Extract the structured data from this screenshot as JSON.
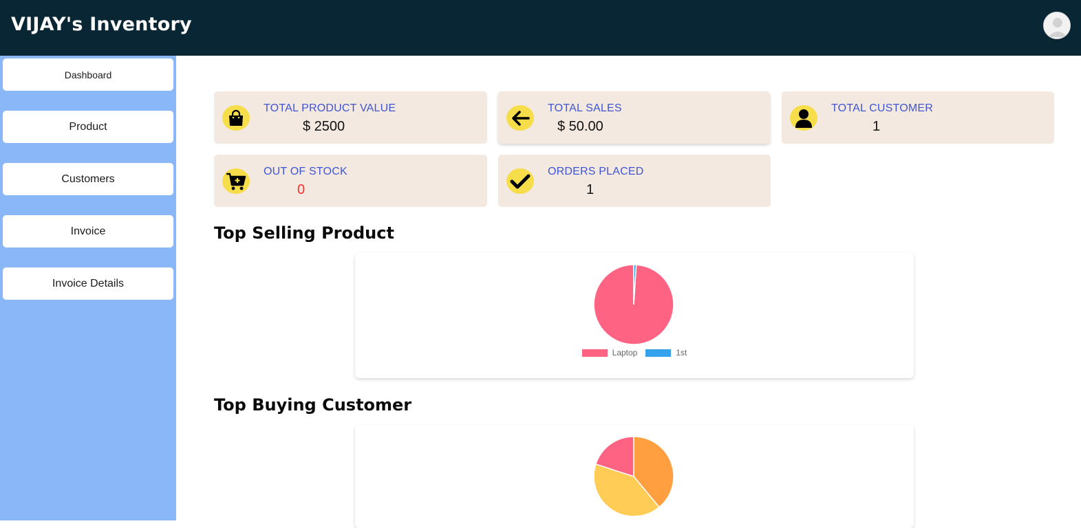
{
  "app": {
    "title": "VIJAY's Inventory"
  },
  "header": {
    "avatar_icon": "user-avatar-icon"
  },
  "sidebar": {
    "items": [
      {
        "label": "Dashboard"
      },
      {
        "label": "Product"
      },
      {
        "label": "Customers"
      },
      {
        "label": "Invoice"
      },
      {
        "label": "Invoice Details"
      }
    ]
  },
  "cards": {
    "total_product_value": {
      "label": "TOTAL PRODUCT VALUE",
      "value": "$ 2500",
      "icon": "shopping-bag-icon"
    },
    "total_sales": {
      "label": "TOTAL SALES",
      "value": "$ 50.00",
      "icon": "arrow-left-icon"
    },
    "total_customer": {
      "label": "TOTAL CUSTOMER",
      "value": "1",
      "icon": "user-icon"
    },
    "out_of_stock": {
      "label": "OUT OF STOCK",
      "value": "0",
      "icon": "cart-plus-icon",
      "value_color": "#ff2d2d"
    },
    "orders_placed": {
      "label": "ORDERS PLACED",
      "value": "1",
      "icon": "checkmark-icon"
    }
  },
  "sections": {
    "top_selling": {
      "title": "Top Selling Product"
    },
    "top_buying": {
      "title": "Top Buying Customer"
    }
  },
  "colors": {
    "topbar": "#092635",
    "sidebar": "#89b7f7",
    "card_bg": "#f3e9e1",
    "card_label": "#3e55d3",
    "icon_bg": "#f6dd4a"
  },
  "chart_data": [
    {
      "type": "pie",
      "categories": [
        "Laptop",
        "1st"
      ],
      "values": [
        99,
        1
      ],
      "colors": [
        "#ff6384",
        "#36a2eb"
      ],
      "legend": "bottom"
    },
    {
      "type": "pie",
      "categories": [
        "",
        "",
        ""
      ],
      "values": [
        39,
        41,
        20
      ],
      "colors": [
        "#ff9f40",
        "#ffcd56",
        "#ff6384"
      ],
      "legend": "bottom"
    }
  ]
}
